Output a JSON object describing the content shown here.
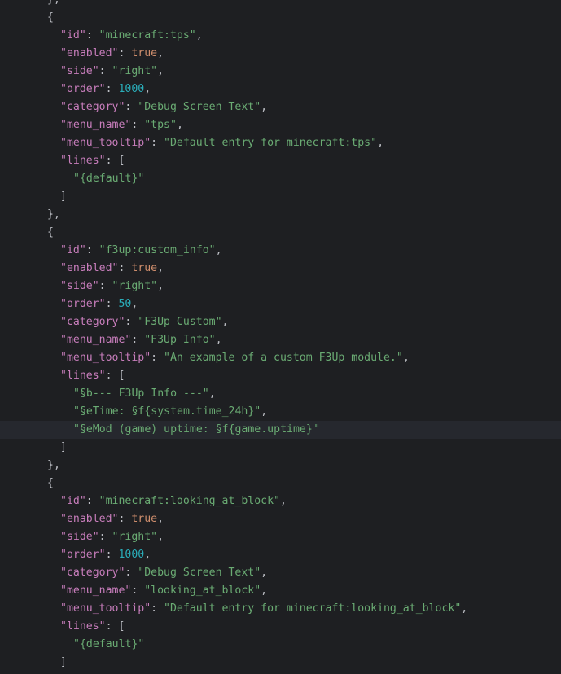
{
  "editor": {
    "language": "json",
    "colors": {
      "background": "#1e1f22",
      "current_line": "#26282e",
      "key": "#c77dbb",
      "string": "#6aab73",
      "number": "#2aacb8",
      "boolean": "#cf8e6d",
      "punctuation": "#bcbec4"
    },
    "lines": [
      [
        {
          "t": "p",
          "v": "},"
        }
      ],
      [
        {
          "t": "p",
          "v": "{"
        }
      ],
      [
        {
          "t": "k",
          "v": "\"id\""
        },
        {
          "t": "p",
          "v": ": "
        },
        {
          "t": "s",
          "v": "\"minecraft:tps\""
        },
        {
          "t": "p",
          "v": ","
        }
      ],
      [
        {
          "t": "k",
          "v": "\"enabled\""
        },
        {
          "t": "p",
          "v": ": "
        },
        {
          "t": "b",
          "v": "true"
        },
        {
          "t": "p",
          "v": ","
        }
      ],
      [
        {
          "t": "k",
          "v": "\"side\""
        },
        {
          "t": "p",
          "v": ": "
        },
        {
          "t": "s",
          "v": "\"right\""
        },
        {
          "t": "p",
          "v": ","
        }
      ],
      [
        {
          "t": "k",
          "v": "\"order\""
        },
        {
          "t": "p",
          "v": ": "
        },
        {
          "t": "n",
          "v": "1000"
        },
        {
          "t": "p",
          "v": ","
        }
      ],
      [
        {
          "t": "k",
          "v": "\"category\""
        },
        {
          "t": "p",
          "v": ": "
        },
        {
          "t": "s",
          "v": "\"Debug Screen Text\""
        },
        {
          "t": "p",
          "v": ","
        }
      ],
      [
        {
          "t": "k",
          "v": "\"menu_name\""
        },
        {
          "t": "p",
          "v": ": "
        },
        {
          "t": "s",
          "v": "\"tps\""
        },
        {
          "t": "p",
          "v": ","
        }
      ],
      [
        {
          "t": "k",
          "v": "\"menu_tooltip\""
        },
        {
          "t": "p",
          "v": ": "
        },
        {
          "t": "s",
          "v": "\"Default entry for minecraft:tps\""
        },
        {
          "t": "p",
          "v": ","
        }
      ],
      [
        {
          "t": "k",
          "v": "\"lines\""
        },
        {
          "t": "p",
          "v": ": ["
        }
      ],
      [
        {
          "t": "s",
          "v": "\"{default}\""
        }
      ],
      [
        {
          "t": "p",
          "v": "]"
        }
      ],
      [
        {
          "t": "p",
          "v": "},"
        }
      ],
      [
        {
          "t": "p",
          "v": "{"
        }
      ],
      [
        {
          "t": "k",
          "v": "\"id\""
        },
        {
          "t": "p",
          "v": ": "
        },
        {
          "t": "s",
          "v": "\"f3up:custom_info\""
        },
        {
          "t": "p",
          "v": ","
        }
      ],
      [
        {
          "t": "k",
          "v": "\"enabled\""
        },
        {
          "t": "p",
          "v": ": "
        },
        {
          "t": "b",
          "v": "true"
        },
        {
          "t": "p",
          "v": ","
        }
      ],
      [
        {
          "t": "k",
          "v": "\"side\""
        },
        {
          "t": "p",
          "v": ": "
        },
        {
          "t": "s",
          "v": "\"right\""
        },
        {
          "t": "p",
          "v": ","
        }
      ],
      [
        {
          "t": "k",
          "v": "\"order\""
        },
        {
          "t": "p",
          "v": ": "
        },
        {
          "t": "n",
          "v": "50"
        },
        {
          "t": "p",
          "v": ","
        }
      ],
      [
        {
          "t": "k",
          "v": "\"category\""
        },
        {
          "t": "p",
          "v": ": "
        },
        {
          "t": "s",
          "v": "\"F3Up Custom\""
        },
        {
          "t": "p",
          "v": ","
        }
      ],
      [
        {
          "t": "k",
          "v": "\"menu_name\""
        },
        {
          "t": "p",
          "v": ": "
        },
        {
          "t": "s",
          "v": "\"F3Up Info\""
        },
        {
          "t": "p",
          "v": ","
        }
      ],
      [
        {
          "t": "k",
          "v": "\"menu_tooltip\""
        },
        {
          "t": "p",
          "v": ": "
        },
        {
          "t": "s",
          "v": "\"An example of a custom F3Up module.\""
        },
        {
          "t": "p",
          "v": ","
        }
      ],
      [
        {
          "t": "k",
          "v": "\"lines\""
        },
        {
          "t": "p",
          "v": ": ["
        }
      ],
      [
        {
          "t": "s",
          "v": "\"§b--- F3Up Info ---\""
        },
        {
          "t": "p",
          "v": ","
        }
      ],
      [
        {
          "t": "s",
          "v": "\"§eTime: §f{system.time_24h}\""
        },
        {
          "t": "p",
          "v": ","
        }
      ],
      [
        {
          "t": "s",
          "v": "\"§eMod (game) uptime: §f{game.uptime}"
        },
        {
          "t": "caret",
          "v": ""
        },
        {
          "t": "s",
          "v": "\""
        }
      ],
      [
        {
          "t": "p",
          "v": "]"
        }
      ],
      [
        {
          "t": "p",
          "v": "},"
        }
      ],
      [
        {
          "t": "p",
          "v": "{"
        }
      ],
      [
        {
          "t": "k",
          "v": "\"id\""
        },
        {
          "t": "p",
          "v": ": "
        },
        {
          "t": "s",
          "v": "\"minecraft:looking_at_block\""
        },
        {
          "t": "p",
          "v": ","
        }
      ],
      [
        {
          "t": "k",
          "v": "\"enabled\""
        },
        {
          "t": "p",
          "v": ": "
        },
        {
          "t": "b",
          "v": "true"
        },
        {
          "t": "p",
          "v": ","
        }
      ],
      [
        {
          "t": "k",
          "v": "\"side\""
        },
        {
          "t": "p",
          "v": ": "
        },
        {
          "t": "s",
          "v": "\"right\""
        },
        {
          "t": "p",
          "v": ","
        }
      ],
      [
        {
          "t": "k",
          "v": "\"order\""
        },
        {
          "t": "p",
          "v": ": "
        },
        {
          "t": "n",
          "v": "1000"
        },
        {
          "t": "p",
          "v": ","
        }
      ],
      [
        {
          "t": "k",
          "v": "\"category\""
        },
        {
          "t": "p",
          "v": ": "
        },
        {
          "t": "s",
          "v": "\"Debug Screen Text\""
        },
        {
          "t": "p",
          "v": ","
        }
      ],
      [
        {
          "t": "k",
          "v": "\"menu_name\""
        },
        {
          "t": "p",
          "v": ": "
        },
        {
          "t": "s",
          "v": "\"looking_at_block\""
        },
        {
          "t": "p",
          "v": ","
        }
      ],
      [
        {
          "t": "k",
          "v": "\"menu_tooltip\""
        },
        {
          "t": "p",
          "v": ": "
        },
        {
          "t": "s",
          "v": "\"Default entry for minecraft:looking_at_block\""
        },
        {
          "t": "p",
          "v": ","
        }
      ],
      [
        {
          "t": "k",
          "v": "\"lines\""
        },
        {
          "t": "p",
          "v": ": ["
        }
      ],
      [
        {
          "t": "s",
          "v": "\"{default}\""
        }
      ],
      [
        {
          "t": "p",
          "v": "]"
        }
      ]
    ]
  }
}
